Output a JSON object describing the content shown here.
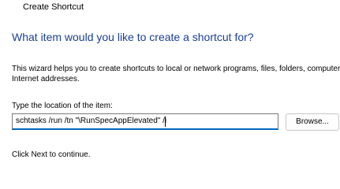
{
  "window": {
    "title": "Create Shortcut"
  },
  "wizard": {
    "heading": "What item would you like to create a shortcut for?",
    "description_line1": "This wizard helps you to create shortcuts to local or network programs, files, folders, computers",
    "description_line2": "Internet addresses.",
    "location_label": "Type the location of the item:",
    "location_value": "schtasks /run /tn \"\\RunSpecAppElevated\" /i",
    "browse_label": "Browse...",
    "footer": "Click Next to continue."
  }
}
